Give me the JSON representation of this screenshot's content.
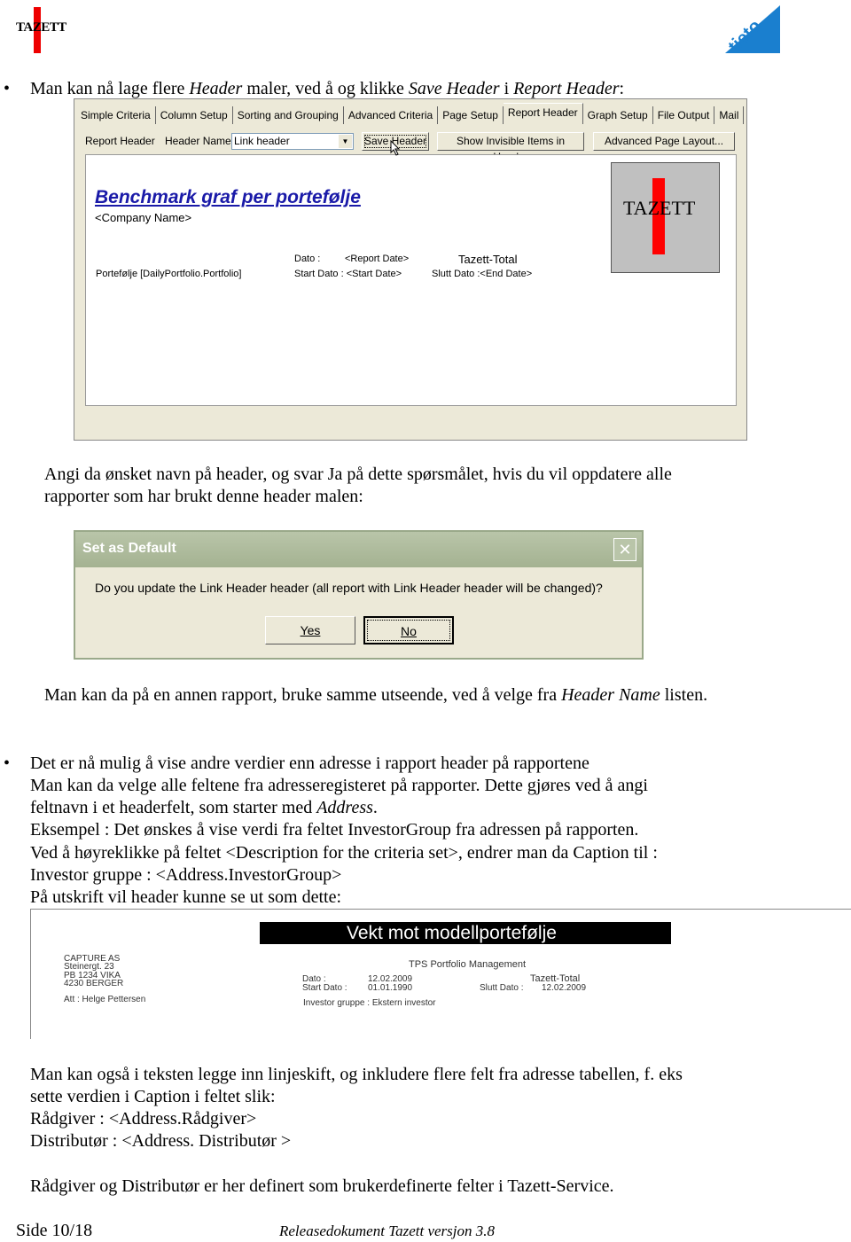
{
  "logos": {
    "left": "TAZETT",
    "right": "tieto"
  },
  "bullet1": {
    "text_parts": [
      "Man kan nå lage flere ",
      "Header",
      " maler, ved å og klikke ",
      "Save Header",
      " i ",
      "Report Header",
      ":"
    ]
  },
  "screen1": {
    "tabs": [
      "Simple Criteria",
      "Column Setup",
      "Sorting and Grouping",
      "Advanced Criteria",
      "Page Setup",
      "Report Header",
      "Graph Setup",
      "File Output",
      "Mail"
    ],
    "active_tab": "Report Header",
    "report_header_label": "Report Header",
    "header_name_label": "Header Name",
    "header_name_value": "Link header",
    "save_header": "Save Header",
    "show_invisible": "Show Invisible Items in Header",
    "advanced_layout": "Advanced Page Layout...",
    "title": "Benchmark graf per portefølje",
    "company": "<Company Name>",
    "dato": "Dato :",
    "report_date": "<Report Date>",
    "tazett_total": "Tazett-Total",
    "portfolio": "Portefølje [DailyPortfolio.Portfolio]",
    "start_dato": "Start Dato : <Start Date>",
    "slutt_dato": "Slutt Dato :<End Date>",
    "logo": "TAZETT"
  },
  "para1": [
    "Angi da ønsket navn på header, og svar Ja på dette spørsmålet, hvis du vil oppdatere alle",
    "rapporter som har brukt denne header malen:"
  ],
  "dialog": {
    "title": "Set as Default",
    "message": "Do you update the Link Header header (all report with Link Header header will be changed)?",
    "yes": "Yes",
    "no": "No"
  },
  "para2": {
    "parts": [
      "Man kan da på en annen rapport, bruke samme utseende, ved å velge fra ",
      "Header Name",
      " listen."
    ]
  },
  "bullet2": {
    "lines": [
      "Det er nå mulig å vise andre verdier enn adresse i rapport header på rapportene",
      "Man kan da velge alle feltene fra adresseregisteret på rapporter. Dette gjøres ved å angi"
    ],
    "line3_parts": [
      "feltnavn i et headerfelt, som starter med ",
      "Address",
      "."
    ],
    "lines_after": [
      "Eksempel : Det ønskes å vise verdi fra feltet InvestorGroup fra adressen på rapporten.",
      "Ved å høyreklikke på feltet <Description for the criteria set>, endrer man da Caption til :",
      "Investor gruppe : <Address.InvestorGroup>",
      "På utskrift vil header kunne se ut som dette:"
    ]
  },
  "print": {
    "title": "Vekt mot modellportefølje",
    "address": [
      "CAPTURE AS",
      "Steinergt. 23",
      "PB 1234 VIKA",
      "4230 BERGER"
    ],
    "att": "Att : Helge Pettersen",
    "company": "TPS Portfolio Management",
    "dato_label": "Dato :",
    "dato": "12.02.2009",
    "start_label": "Start Dato :",
    "start": "01.01.1990",
    "total": "Tazett-Total",
    "slutt_label": "Slutt Dato :",
    "slutt": "12.02.2009",
    "investor": "Investor gruppe : Ekstern investor"
  },
  "para3": [
    "Man kan også i teksten legge inn linjeskift, og inkludere flere felt fra adresse tabellen, f. eks",
    "sette verdien i Caption i feltet slik:",
    "Rådgiver : <Address.Rådgiver>",
    "Distributør : <Address. Distributør >"
  ],
  "para4": "Rådgiver og Distributør er her definert som brukerdefinerte felter i Tazett-Service.",
  "footer": {
    "page": "Side 10/18",
    "doc": "Releasedokument Tazett versjon 3.8"
  }
}
